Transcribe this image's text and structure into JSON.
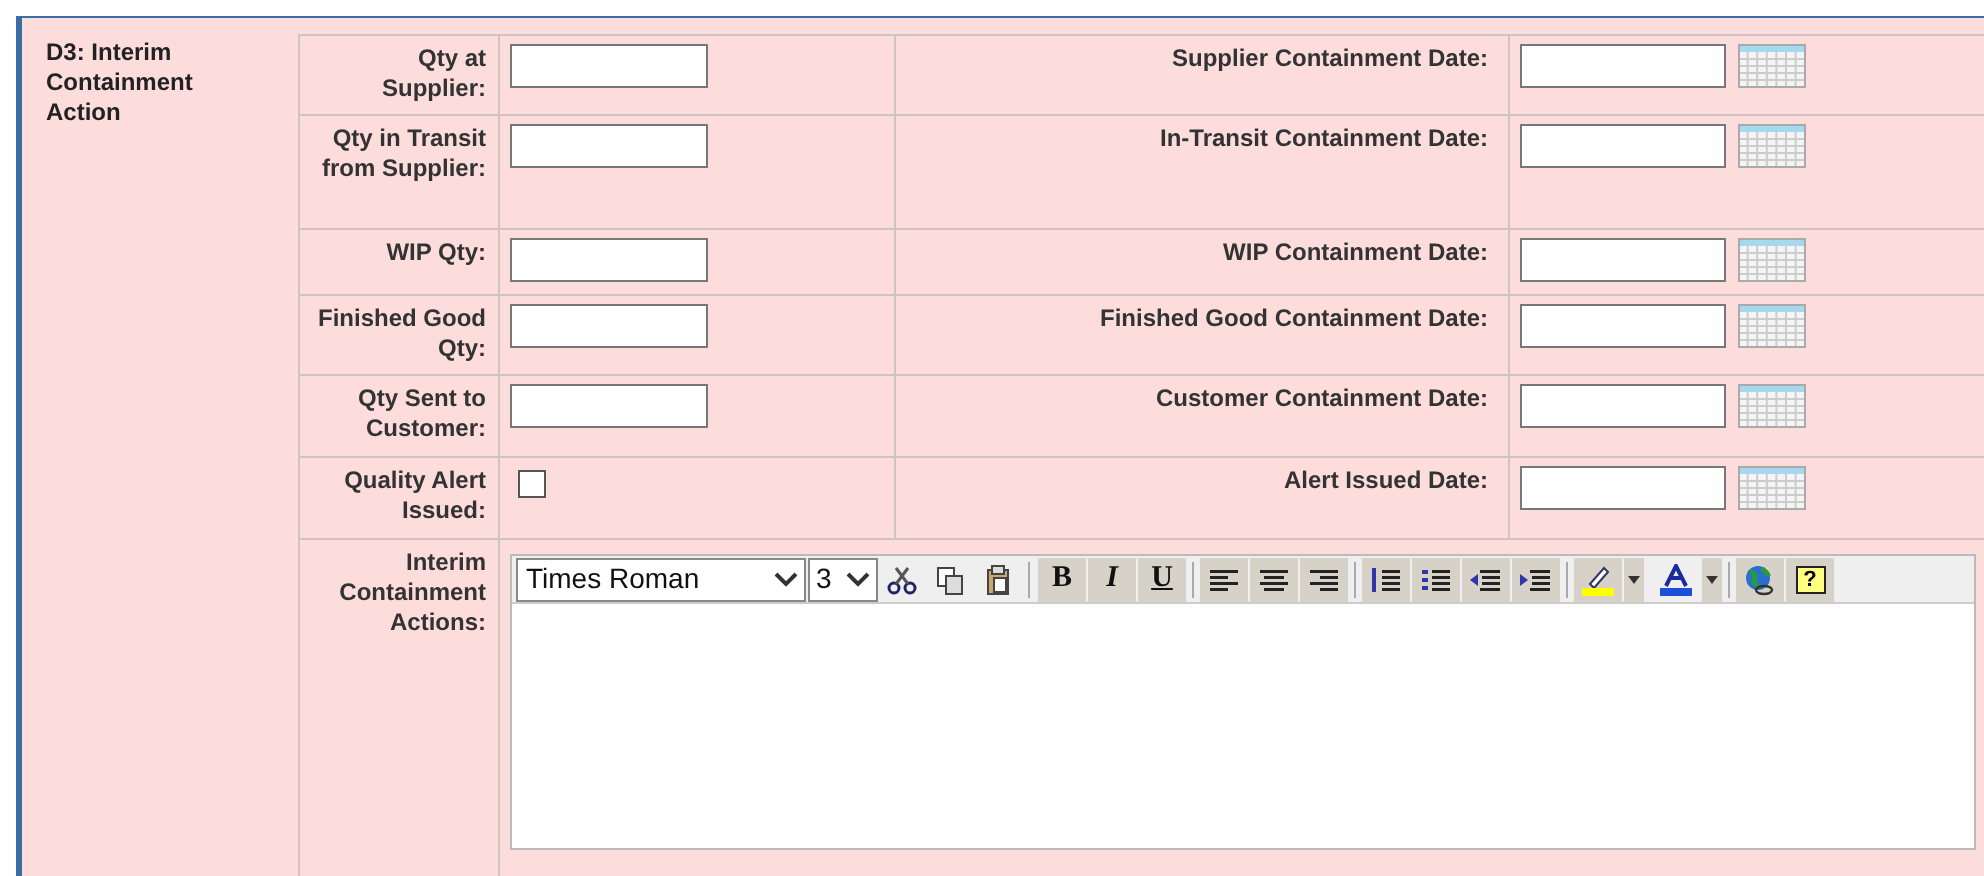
{
  "section": {
    "title": "D3: Interim Containment Action"
  },
  "rows": [
    {
      "kind": "quantity",
      "label": "Qty at Supplier:",
      "date_label": "Supplier Containment Date:"
    },
    {
      "kind": "quantity",
      "label": "Qty in Transit from Supplier:",
      "date_label": "In-Transit Containment Date:"
    },
    {
      "kind": "quantity",
      "label": "WIP Qty:",
      "date_label": "WIP Containment Date:"
    },
    {
      "kind": "quantity",
      "label": "Finished Good Qty:",
      "date_label": "Finished Good Containment Date:"
    },
    {
      "kind": "quantity",
      "label": "Qty Sent to Customer:",
      "date_label": "Customer Containment Date:"
    },
    {
      "kind": "checkbox",
      "label": "Quality Alert Issued:",
      "checked": false,
      "date_label": "Alert Issued Date:"
    }
  ],
  "editor": {
    "label": "Interim Containment Actions:",
    "font": "Times Roman",
    "size": "3",
    "format_buttons": [
      "B",
      "I",
      "U"
    ],
    "help": "?"
  }
}
